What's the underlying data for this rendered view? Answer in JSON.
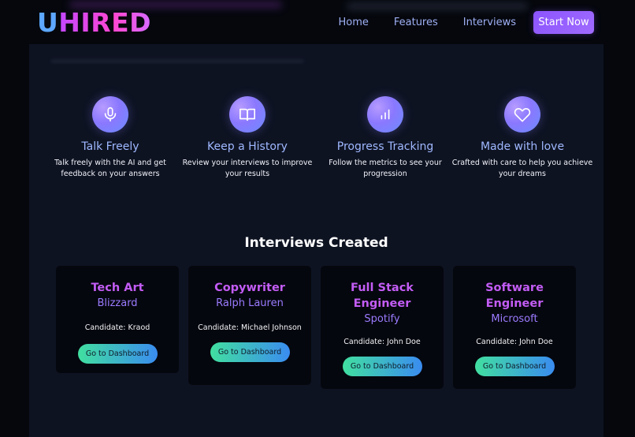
{
  "header": {
    "logo_first": "U",
    "logo_rest": "HIRED",
    "nav": [
      "Home",
      "Features",
      "Interviews"
    ],
    "cta": "Start Now"
  },
  "features": [
    {
      "icon": "microphone-icon",
      "title": "Talk Freely",
      "desc": "Talk freely with the AI and get feedback on your answers"
    },
    {
      "icon": "book-icon",
      "title": "Keep a History",
      "desc": "Review your interviews to improve your results"
    },
    {
      "icon": "bar-chart-icon",
      "title": "Progress Tracking",
      "desc": "Follow the metrics to see your progression"
    },
    {
      "icon": "heart-icon",
      "title": "Made with love",
      "desc": "Crafted with care to help you achieve your dreams"
    }
  ],
  "interviews": {
    "title": "Interviews Created",
    "cards": [
      {
        "role": "Tech Art",
        "company": "Blizzard",
        "candidate": "Candidate: Kraod",
        "button": "Go to Dashboard"
      },
      {
        "role": "Copywriter",
        "company": "Ralph Lauren",
        "candidate": "Candidate: Michael Johnson",
        "button": "Go to Dashboard"
      },
      {
        "role": "Full Stack Engineer",
        "company": "Spotify",
        "candidate": "Candidate: John Doe",
        "button": "Go to Dashboard"
      },
      {
        "role": "Software Engineer",
        "company": "Microsoft",
        "candidate": "Candidate: John Doe",
        "button": "Go to Dashboard"
      }
    ]
  },
  "colors": {
    "background": "#05070d",
    "panel": "#0e1322",
    "card": "#05070e",
    "accent_purple": "#8c54ff",
    "role_title": "#c35cf5",
    "company": "#9b7bff",
    "button_gradient_start": "#41dfa0",
    "button_gradient_end": "#3a8cf0"
  }
}
